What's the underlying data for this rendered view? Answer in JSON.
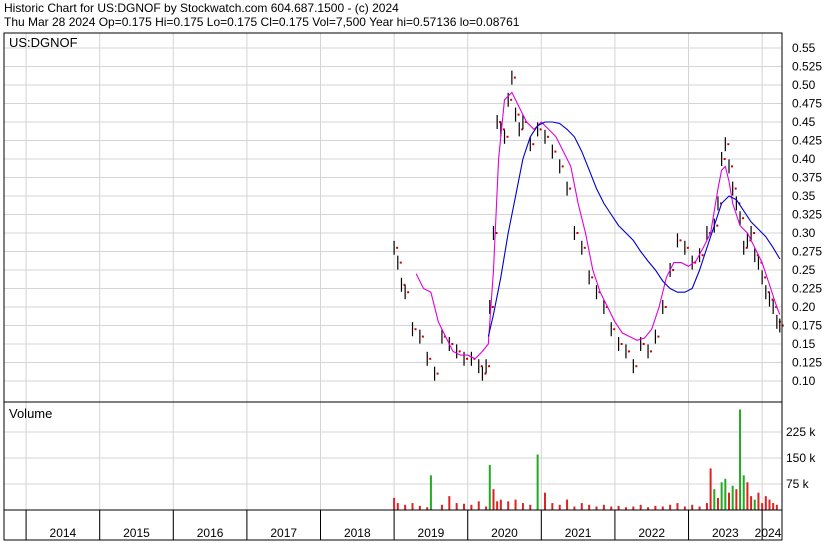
{
  "header": {
    "line1": "Historic Chart for US:DGNOF by Stockwatch.com 604.687.1500 - (c) 2024",
    "line2": "Thu Mar 28 2024   Op=0.175   Hi=0.175   Lo=0.175   Cl=0.175   Vol=7,500   Year hi=0.57136   lo=0.08761"
  },
  "chart_data": [
    {
      "type": "line",
      "title": "US:DGNOF",
      "ylabel": "",
      "xlabel": "",
      "grid": true,
      "y_ticks": [
        "0.55",
        "0.525",
        "0.50",
        "0.475",
        "0.45",
        "0.425",
        "0.40",
        "0.375",
        "0.35",
        "0.325",
        "0.30",
        "0.275",
        "0.25",
        "0.225",
        "0.20",
        "0.175",
        "0.15",
        "0.125",
        "0.10"
      ],
      "ylim": [
        0.08761,
        0.57136
      ],
      "x_ticks": [
        "2014",
        "2015",
        "2016",
        "2017",
        "2018",
        "2019",
        "2020",
        "2021",
        "2022",
        "2023",
        "2024"
      ],
      "series_colors": {
        "price": "#000000",
        "close_marks": "#cc0000",
        "ma_short": "#e000e0",
        "ma_long": "#0000cc"
      },
      "series": [
        {
          "name": "",
          "role": "price",
          "x": [
            2019.0,
            2019.05,
            2019.1,
            2019.15,
            2019.25,
            2019.35,
            2019.45,
            2019.55,
            2019.65,
            2019.75,
            2019.85,
            2019.95,
            2020.05,
            2020.15,
            2020.2,
            2020.25,
            2020.3,
            2020.35,
            2020.4,
            2020.45,
            2020.5,
            2020.55,
            2020.6,
            2020.65,
            2020.7,
            2020.75,
            2020.85,
            2020.95,
            2021.05,
            2021.15,
            2021.25,
            2021.35,
            2021.45,
            2021.55,
            2021.65,
            2021.75,
            2021.85,
            2021.95,
            2022.05,
            2022.15,
            2022.25,
            2022.35,
            2022.45,
            2022.55,
            2022.65,
            2022.75,
            2022.85,
            2022.95,
            2023.05,
            2023.15,
            2023.25,
            2023.35,
            2023.4,
            2023.45,
            2023.5,
            2023.55,
            2023.6,
            2023.65,
            2023.7,
            2023.75,
            2023.8,
            2023.85,
            2023.9,
            2023.95,
            2024.0,
            2024.05,
            2024.1,
            2024.15,
            2024.2,
            2024.24
          ],
          "values": [
            0.28,
            0.26,
            0.23,
            0.22,
            0.17,
            0.16,
            0.13,
            0.11,
            0.16,
            0.15,
            0.14,
            0.13,
            0.13,
            0.12,
            0.11,
            0.12,
            0.2,
            0.3,
            0.45,
            0.44,
            0.43,
            0.48,
            0.51,
            0.46,
            0.44,
            0.45,
            0.42,
            0.44,
            0.43,
            0.41,
            0.39,
            0.36,
            0.3,
            0.28,
            0.24,
            0.22,
            0.2,
            0.17,
            0.15,
            0.14,
            0.12,
            0.15,
            0.14,
            0.16,
            0.2,
            0.25,
            0.29,
            0.28,
            0.26,
            0.27,
            0.3,
            0.31,
            0.34,
            0.4,
            0.42,
            0.39,
            0.36,
            0.34,
            0.32,
            0.28,
            0.29,
            0.3,
            0.27,
            0.26,
            0.24,
            0.22,
            0.21,
            0.2,
            0.18,
            0.175
          ]
        },
        {
          "name": "",
          "role": "ma_short",
          "x": [
            2019.3,
            2019.4,
            2019.5,
            2019.6,
            2019.7,
            2019.8,
            2019.9,
            2020.0,
            2020.1,
            2020.2,
            2020.28,
            2020.35,
            2020.42,
            2020.5,
            2020.6,
            2020.7,
            2020.8,
            2020.9,
            2021.0,
            2021.1,
            2021.2,
            2021.3,
            2021.4,
            2021.5,
            2021.6,
            2021.7,
            2021.8,
            2021.9,
            2022.0,
            2022.1,
            2022.2,
            2022.3,
            2022.4,
            2022.5,
            2022.6,
            2022.7,
            2022.8,
            2022.9,
            2023.0,
            2023.1,
            2023.2,
            2023.3,
            2023.35,
            2023.4,
            2023.45,
            2023.5,
            2023.55,
            2023.6,
            2023.7,
            2023.8,
            2023.9,
            2024.0,
            2024.1,
            2024.2,
            2024.24
          ],
          "values": [
            0.245,
            0.225,
            0.22,
            0.18,
            0.16,
            0.14,
            0.135,
            0.135,
            0.13,
            0.14,
            0.15,
            0.25,
            0.4,
            0.48,
            0.49,
            0.47,
            0.45,
            0.44,
            0.45,
            0.44,
            0.43,
            0.41,
            0.39,
            0.34,
            0.3,
            0.25,
            0.22,
            0.2,
            0.18,
            0.165,
            0.16,
            0.155,
            0.158,
            0.17,
            0.2,
            0.24,
            0.26,
            0.26,
            0.255,
            0.262,
            0.28,
            0.3,
            0.33,
            0.36,
            0.385,
            0.39,
            0.37,
            0.34,
            0.31,
            0.3,
            0.28,
            0.26,
            0.23,
            0.2,
            0.19
          ]
        },
        {
          "name": "",
          "role": "ma_long",
          "x": [
            2020.28,
            2020.35,
            2020.45,
            2020.55,
            2020.65,
            2020.75,
            2020.85,
            2020.95,
            2021.05,
            2021.15,
            2021.25,
            2021.35,
            2021.45,
            2021.55,
            2021.65,
            2021.75,
            2021.85,
            2021.95,
            2022.05,
            2022.15,
            2022.25,
            2022.35,
            2022.45,
            2022.55,
            2022.65,
            2022.75,
            2022.85,
            2022.95,
            2023.05,
            2023.15,
            2023.25,
            2023.35,
            2023.45,
            2023.55,
            2023.65,
            2023.75,
            2023.85,
            2023.95,
            2024.05,
            2024.15,
            2024.24
          ],
          "values": [
            0.16,
            0.19,
            0.24,
            0.3,
            0.35,
            0.4,
            0.43,
            0.445,
            0.45,
            0.45,
            0.448,
            0.44,
            0.43,
            0.41,
            0.385,
            0.36,
            0.34,
            0.325,
            0.31,
            0.3,
            0.29,
            0.275,
            0.262,
            0.25,
            0.235,
            0.225,
            0.22,
            0.22,
            0.225,
            0.25,
            0.28,
            0.31,
            0.34,
            0.35,
            0.345,
            0.33,
            0.315,
            0.305,
            0.295,
            0.28,
            0.265
          ]
        }
      ]
    },
    {
      "type": "bar",
      "title": "Volume",
      "y_ticks": [
        "225 k",
        "150 k",
        "75 k"
      ],
      "ylim": [
        0,
        300000
      ],
      "colors": {
        "up": "#22aa22",
        "down": "#dd2222"
      },
      "x": [
        2019.0,
        2019.05,
        2019.15,
        2019.25,
        2019.35,
        2019.45,
        2019.5,
        2019.65,
        2019.75,
        2019.85,
        2019.95,
        2020.05,
        2020.15,
        2020.25,
        2020.3,
        2020.35,
        2020.4,
        2020.45,
        2020.55,
        2020.65,
        2020.75,
        2020.85,
        2020.95,
        2021.05,
        2021.15,
        2021.25,
        2021.35,
        2021.45,
        2021.55,
        2021.65,
        2021.75,
        2021.85,
        2021.95,
        2022.05,
        2022.15,
        2022.25,
        2022.35,
        2022.45,
        2022.55,
        2022.65,
        2022.75,
        2022.85,
        2022.95,
        2023.05,
        2023.15,
        2023.25,
        2023.3,
        2023.35,
        2023.4,
        2023.45,
        2023.5,
        2023.55,
        2023.6,
        2023.65,
        2023.7,
        2023.75,
        2023.8,
        2023.85,
        2023.9,
        2023.95,
        2024.0,
        2024.05,
        2024.1,
        2024.15,
        2024.2
      ],
      "values": [
        35000,
        20000,
        15000,
        20000,
        12000,
        8000,
        100000,
        15000,
        40000,
        20000,
        18000,
        15000,
        25000,
        10000,
        130000,
        60000,
        25000,
        30000,
        25000,
        30000,
        20000,
        15000,
        160000,
        50000,
        20000,
        15000,
        30000,
        10000,
        20000,
        15000,
        10000,
        15000,
        10000,
        12000,
        8000,
        10000,
        15000,
        8000,
        12000,
        10000,
        15000,
        20000,
        10000,
        15000,
        10000,
        20000,
        120000,
        60000,
        35000,
        80000,
        90000,
        50000,
        70000,
        60000,
        290000,
        100000,
        80000,
        40000,
        30000,
        50000,
        20000,
        40000,
        30000,
        20000,
        15000
      ],
      "up": [
        false,
        false,
        false,
        false,
        false,
        false,
        true,
        false,
        false,
        false,
        false,
        false,
        false,
        false,
        true,
        false,
        false,
        false,
        false,
        false,
        false,
        false,
        true,
        false,
        false,
        false,
        false,
        false,
        false,
        false,
        false,
        false,
        false,
        false,
        false,
        false,
        false,
        false,
        false,
        false,
        false,
        false,
        false,
        false,
        false,
        false,
        false,
        true,
        false,
        true,
        true,
        false,
        true,
        false,
        true,
        true,
        false,
        false,
        true,
        false,
        false,
        false,
        false,
        false,
        false
      ]
    }
  ]
}
